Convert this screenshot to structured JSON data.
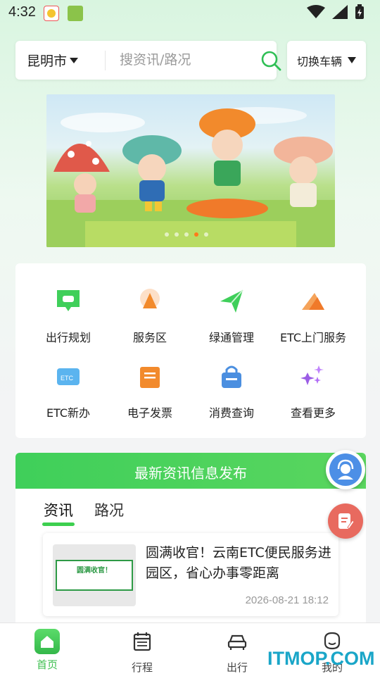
{
  "status_bar": {
    "time": "4:32"
  },
  "search": {
    "city": "昆明市",
    "placeholder": "搜资讯/路况"
  },
  "vehicle_switch": {
    "label": "切换车辆"
  },
  "banner": {
    "slide_count": 5,
    "active_index": 4
  },
  "services": [
    {
      "label": "出行规划",
      "icon": "trip-planning-icon"
    },
    {
      "label": "服务区",
      "icon": "service-area-icon"
    },
    {
      "label": "绿通管理",
      "icon": "green-channel-icon"
    },
    {
      "label": "ETC上门服务",
      "icon": "etc-doorstep-icon"
    },
    {
      "label": "ETC新办",
      "icon": "etc-card-icon"
    },
    {
      "label": "电子发票",
      "icon": "invoice-icon"
    },
    {
      "label": "消费查询",
      "icon": "consumption-query-icon"
    },
    {
      "label": "查看更多",
      "icon": "more-icon"
    }
  ],
  "news": {
    "header": "最新资讯信息发布",
    "tabs": [
      "资讯",
      "路况"
    ],
    "active_tab": 0,
    "items": [
      {
        "thumb_text": "圆满收官！",
        "title": "圆满收官！云南ETC便民服务进园区，省心办事零距离",
        "date": "2026-08-21 18:12"
      }
    ]
  },
  "bottom_nav": [
    {
      "label": "首页",
      "icon": "home-icon",
      "active": true
    },
    {
      "label": "行程",
      "icon": "calendar-icon",
      "active": false
    },
    {
      "label": "出行",
      "icon": "car-icon",
      "active": false
    },
    {
      "label": "我的",
      "icon": "profile-icon",
      "active": false
    }
  ],
  "watermark": "ITMOP.COM",
  "colors": {
    "accent": "#3dcf4f",
    "header_green": "#4fd35c",
    "date_gray": "#999999"
  }
}
